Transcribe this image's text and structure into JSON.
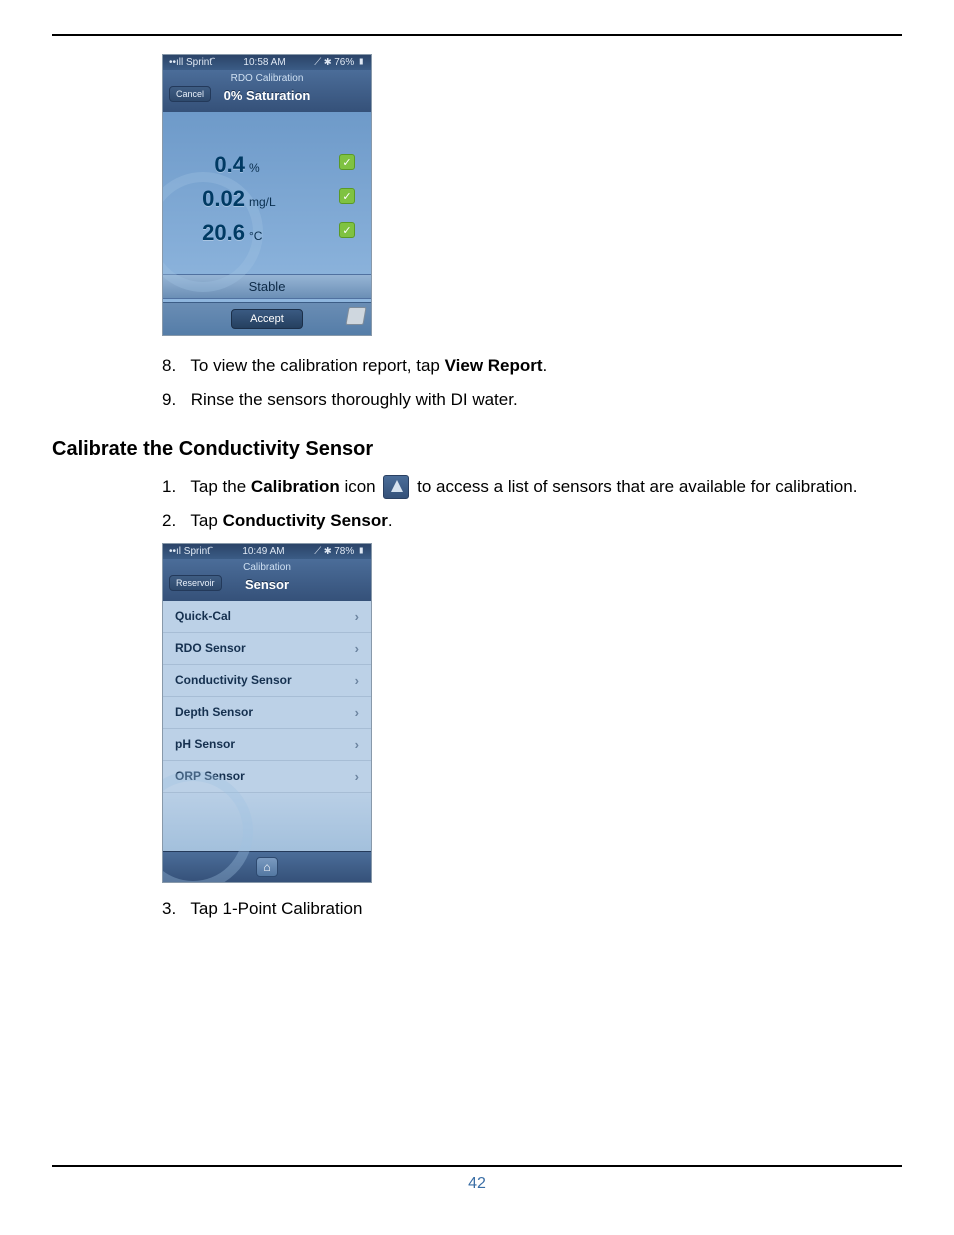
{
  "pageNumber": "42",
  "screenshot1": {
    "statusLeft": "Sprint",
    "statusTime": "10:58 AM",
    "statusRight": "76%",
    "navSmall": "RDO Calibration",
    "cancel": "Cancel",
    "navTitle": "0% Saturation",
    "r1_val": "0.4",
    "r1_unit": "%",
    "r2_val": "0.02",
    "r2_unit": "mg/L",
    "r3_val": "20.6",
    "r3_unit": "°C",
    "stable": "Stable",
    "accept": "Accept"
  },
  "stepsA": {
    "s8_num": "8.",
    "s8_a": "To view the calibration report, tap ",
    "s8_b": "View Report",
    "s8_c": ".",
    "s9_num": "9.",
    "s9_a": "Rinse the sensors thoroughly with DI water."
  },
  "heading": "Calibrate the Conductivity Sensor",
  "stepsB": {
    "s1_num": "1.",
    "s1_a": "Tap the ",
    "s1_b": "Calibration",
    "s1_c": " icon",
    "s1_d": " to access a list of sensors that are available for calibration.",
    "s2_num": "2.",
    "s2_a": "Tap ",
    "s2_b": "Conductivity Sensor",
    "s2_c": ".",
    "s3_num": "3.",
    "s3_a": "Tap 1-Point Calibration"
  },
  "screenshot2": {
    "statusLeft": "Sprint",
    "statusTime": "10:49 AM",
    "statusRight": "78%",
    "navSmall": "Calibration",
    "back": "Reservoir",
    "navTitle": "Sensor",
    "rows": [
      "Quick-Cal",
      "RDO Sensor",
      "Conductivity Sensor",
      "Depth Sensor",
      "pH Sensor",
      "ORP Sensor"
    ]
  }
}
